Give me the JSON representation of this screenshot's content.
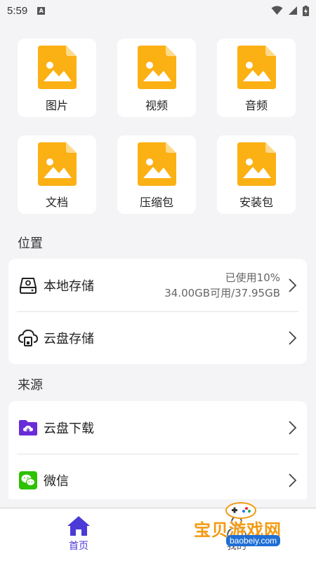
{
  "status": {
    "time": "5:59",
    "badge": "A"
  },
  "categories": [
    {
      "label": "图片"
    },
    {
      "label": "视频"
    },
    {
      "label": "音频"
    },
    {
      "label": "文档"
    },
    {
      "label": "压缩包"
    },
    {
      "label": "安装包"
    }
  ],
  "location": {
    "title": "位置",
    "local": {
      "label": "本地存储",
      "used": "已使用10%",
      "capacity": "34.00GB可用/37.95GB"
    },
    "cloud": {
      "label": "云盘存储"
    }
  },
  "source": {
    "title": "来源",
    "download": {
      "label": "云盘下载"
    },
    "wechat": {
      "label": "微信"
    }
  },
  "nav": {
    "home": "首页",
    "mine": "我的"
  },
  "watermark": {
    "text": "宝贝游戏网",
    "url": "baobeiy.com"
  },
  "colors": {
    "file_icon": "#fbb014",
    "accent": "#4b3bd6",
    "wechat": "#2dc100",
    "folder": "#6a2bd8"
  }
}
